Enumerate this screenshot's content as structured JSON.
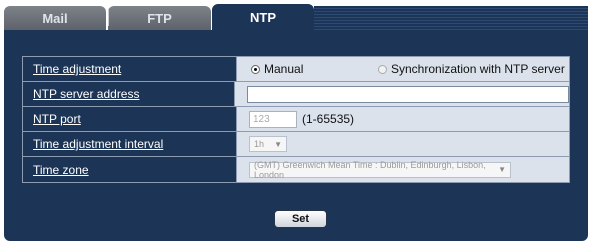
{
  "tabs": [
    {
      "label": "Mail"
    },
    {
      "label": "FTP"
    },
    {
      "label": "NTP"
    }
  ],
  "settings": {
    "time_adjustment": {
      "label": "Time adjustment",
      "option_manual": "Manual",
      "option_sync": "Synchronization with NTP server",
      "selected": "Manual"
    },
    "ntp_server_address": {
      "label": "NTP server address",
      "value": ""
    },
    "ntp_port": {
      "label": "NTP port",
      "value": "123",
      "range_hint": "(1-65535)"
    },
    "time_adjustment_interval": {
      "label": "Time adjustment interval",
      "selected": "1h"
    },
    "time_zone": {
      "label": "Time zone",
      "selected": "(GMT) Greenwich Mean Time : Dublin, Edinburgh, Lisbon, London"
    }
  },
  "buttons": {
    "set": "Set"
  },
  "colors": {
    "panel": "#1c3456",
    "value_cell": "#dbe2eb",
    "inactive_tab": "#6e737b"
  }
}
